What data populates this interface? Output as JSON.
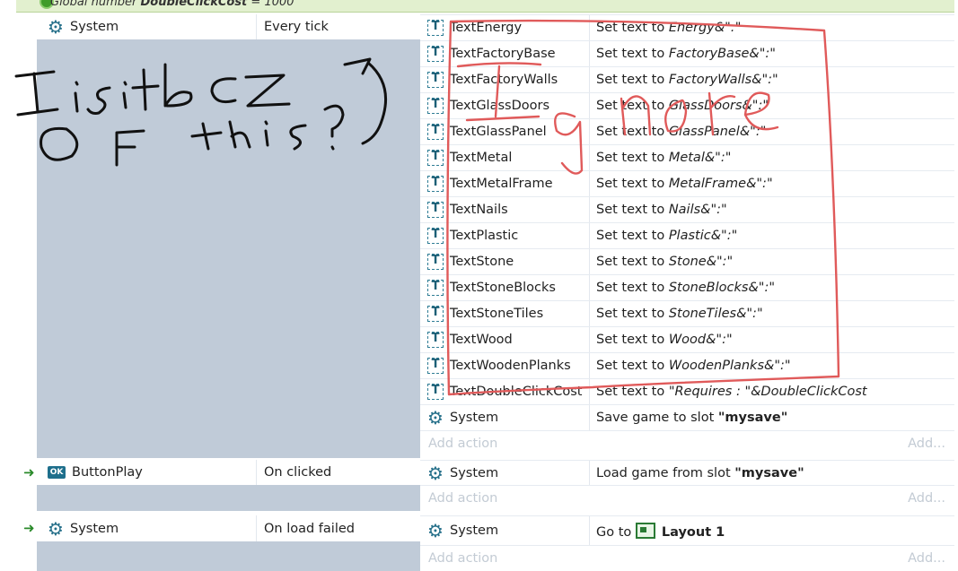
{
  "global_var": {
    "prefix": "Global number",
    "name": "DoubleClickCost",
    "value": "= 1000"
  },
  "events": [
    {
      "condition": {
        "object": "System",
        "text": "Every tick"
      },
      "actions": [
        {
          "object": "TextEnergy",
          "pre": "Set text to ",
          "param": "Energy",
          "suffix": "&\":\""
        },
        {
          "object": "TextFactoryBase",
          "pre": "Set text to ",
          "param": "FactoryBase",
          "suffix": "&\":\""
        },
        {
          "object": "TextFactoryWalls",
          "pre": "Set text to ",
          "param": "FactoryWalls",
          "suffix": "&\":\""
        },
        {
          "object": "TextGlassDoors",
          "pre": "Set text to ",
          "param": "GlassDoors",
          "suffix": "&\":\""
        },
        {
          "object": "TextGlassPanel",
          "pre": "Set text to ",
          "param": "GlassPanel",
          "suffix": "&\":\""
        },
        {
          "object": "TextMetal",
          "pre": "Set text to ",
          "param": "Metal",
          "suffix": "&\":\""
        },
        {
          "object": "TextMetalFrame",
          "pre": "Set text to ",
          "param": "MetalFrame",
          "suffix": "&\":\""
        },
        {
          "object": "TextNails",
          "pre": "Set text to ",
          "param": "Nails",
          "suffix": "&\":\""
        },
        {
          "object": "TextPlastic",
          "pre": "Set text to ",
          "param": "Plastic",
          "suffix": "&\":\""
        },
        {
          "object": "TextStone",
          "pre": "Set text to ",
          "param": "Stone",
          "suffix": "&\":\""
        },
        {
          "object": "TextStoneBlocks",
          "pre": "Set text to ",
          "param": "StoneBlocks",
          "suffix": "&\":\""
        },
        {
          "object": "TextStoneTiles",
          "pre": "Set text to ",
          "param": "StoneTiles",
          "suffix": "&\":\""
        },
        {
          "object": "TextWood",
          "pre": "Set text to ",
          "param": "Wood",
          "suffix": "&\":\""
        },
        {
          "object": "TextWoodenPlanks",
          "pre": "Set text to ",
          "param": "WoodenPlanks",
          "suffix": "&\":\""
        },
        {
          "object": "TextDoubleClickCost",
          "pre": "Set text to ",
          "param": "\"Requires : \"&DoubleClickCost",
          "suffix": ""
        },
        {
          "object": "System",
          "pre": "Save game to slot ",
          "param": "\"mysave\"",
          "suffix": ""
        }
      ]
    },
    {
      "condition": {
        "object": "ButtonPlay",
        "text": "On clicked"
      },
      "actions": [
        {
          "object": "System",
          "pre": "Load game from slot ",
          "param": "\"mysave\"",
          "suffix": ""
        }
      ]
    },
    {
      "condition": {
        "object": "System",
        "text": "On load failed"
      },
      "actions": [
        {
          "object": "System",
          "pre": "Go to ",
          "param": "Layout 1",
          "suffix": ""
        }
      ]
    }
  ],
  "add_action": {
    "label": "Add action",
    "right": "Add..."
  },
  "icons": {
    "ok_badge": "OK",
    "text_glyph": "T",
    "gear_glyph": "⚙",
    "arrow_glyph": "➜"
  },
  "annotation": {
    "left_note": "Is it bcz of this?",
    "box_note": "Ignore",
    "color": "#e05a5a"
  }
}
